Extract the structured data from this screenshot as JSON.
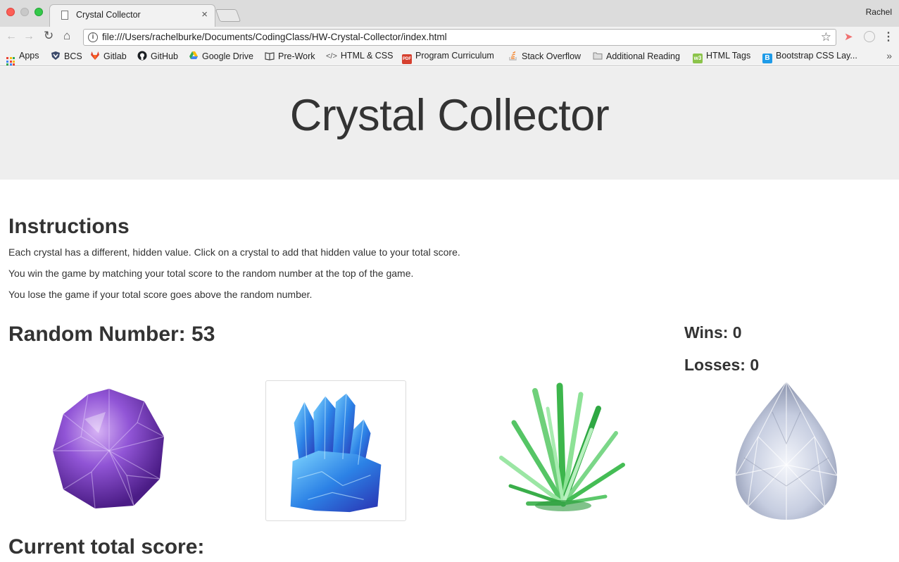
{
  "browser": {
    "tab_title": "Crystal Collector",
    "tab_close": "×",
    "user_name": "Rachel",
    "url": "file:///Users/rachelburke/Documents/CodingClass/HW-Crystal-Collector/index.html",
    "bookmarks": [
      {
        "label": "Apps",
        "icon": "apps-grid-icon"
      },
      {
        "label": "BCS",
        "icon": "shield-icon"
      },
      {
        "label": "Gitlab",
        "icon": "gitlab-icon"
      },
      {
        "label": "GitHub",
        "icon": "github-icon"
      },
      {
        "label": "Google Drive",
        "icon": "google-drive-icon"
      },
      {
        "label": "Pre-Work",
        "icon": "book-icon"
      },
      {
        "label": "HTML & CSS",
        "icon": "code-icon"
      },
      {
        "label": "Program Curriculum",
        "icon": "pdf-icon"
      },
      {
        "label": "Stack Overflow",
        "icon": "stackoverflow-icon"
      },
      {
        "label": "Additional Reading",
        "icon": "folder-icon"
      },
      {
        "label": "HTML Tags",
        "icon": "w3-icon"
      },
      {
        "label": "Bootstrap CSS Lay...",
        "icon": "bootstrap-icon"
      }
    ],
    "bookmarks_overflow": "»"
  },
  "page": {
    "title": "Crystal Collector",
    "instructions_heading": "Instructions",
    "instructions": [
      "Each crystal has a different, hidden value. Click on a crystal to add that hidden value to your total score.",
      "You win the game by matching your total score to the random number at the top of the game.",
      "You lose the game if your total score goes above the random number."
    ],
    "random_number_label": "Random Number: 53",
    "wins_label": "Wins: 0",
    "losses_label": "Losses: 0",
    "crystals": [
      {
        "name": "purple-amethyst-crystal",
        "color": "#8a4fc7"
      },
      {
        "name": "blue-quartz-crystal",
        "color": "#2f7de0"
      },
      {
        "name": "green-spike-crystal",
        "color": "#3dbb4f"
      },
      {
        "name": "clear-teardrop-crystal",
        "color": "#c9d0de"
      }
    ],
    "current_score_label": "Current total score:"
  }
}
